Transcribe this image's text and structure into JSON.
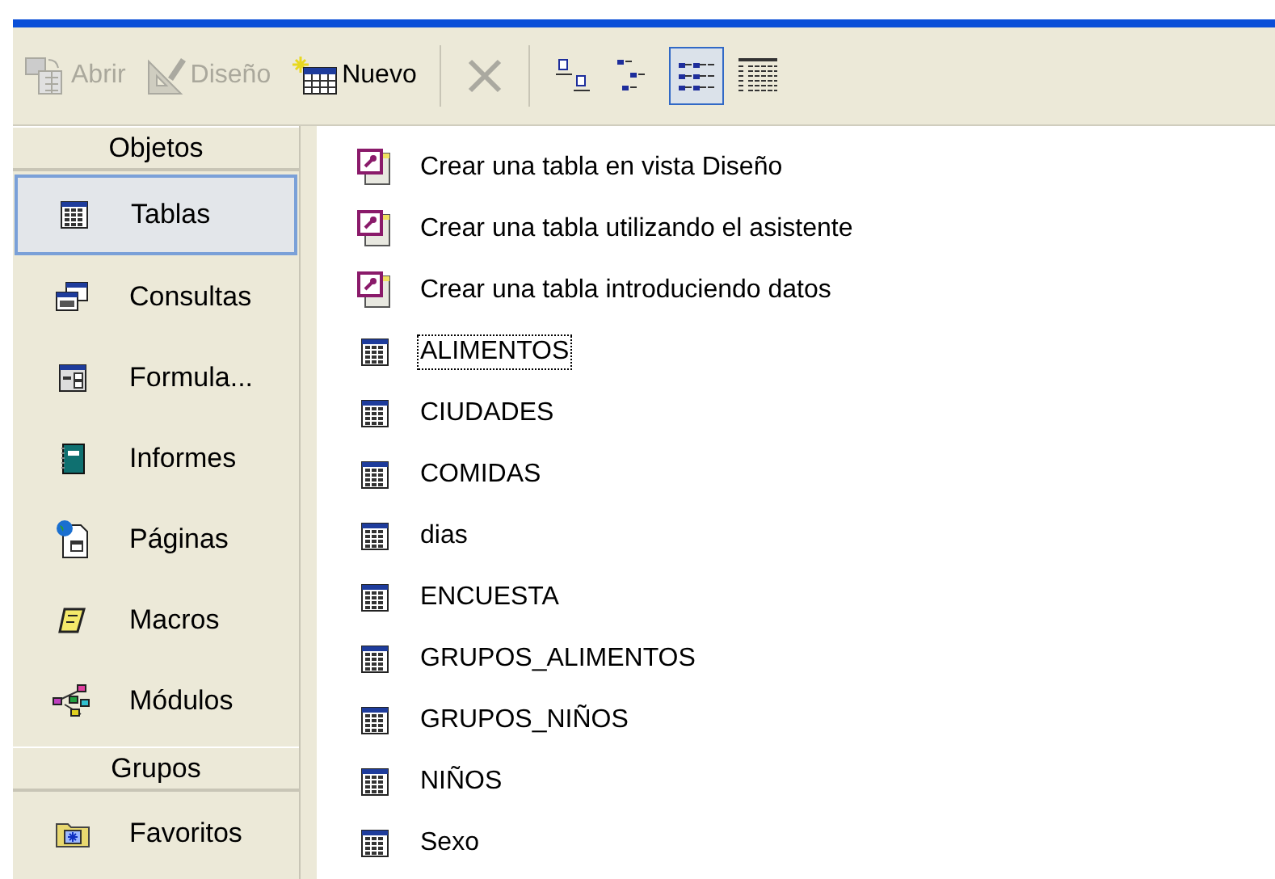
{
  "toolbar": [
    {
      "kind": "open",
      "label": "Abrir",
      "disabled": true
    },
    {
      "kind": "design",
      "label": "Diseño",
      "disabled": true
    },
    {
      "kind": "new",
      "label": "Nuevo",
      "disabled": false
    },
    {
      "kind": "delete",
      "disabled": true
    },
    {
      "kind": "large-icons",
      "selected": false
    },
    {
      "kind": "small-icons",
      "selected": false
    },
    {
      "kind": "list",
      "selected": true
    },
    {
      "kind": "details",
      "selected": false
    }
  ],
  "sidebar": {
    "sections": [
      {
        "title": "Objetos",
        "items": [
          {
            "kind": "tables",
            "label": "Tablas",
            "selected": true
          },
          {
            "kind": "queries",
            "label": "Consultas",
            "selected": false
          },
          {
            "kind": "forms",
            "label": "Formula...",
            "selected": false
          },
          {
            "kind": "reports",
            "label": "Informes",
            "selected": false
          },
          {
            "kind": "pages",
            "label": "Páginas",
            "selected": false
          },
          {
            "kind": "macros",
            "label": "Macros",
            "selected": false
          },
          {
            "kind": "modules",
            "label": "Módulos",
            "selected": false
          }
        ]
      },
      {
        "title": "Grupos",
        "items": [
          {
            "kind": "favorites",
            "label": "Favoritos",
            "selected": false
          }
        ]
      }
    ]
  },
  "objects": [
    {
      "kind": "wizard",
      "label": "Crear una tabla en vista Diseño",
      "focused": false
    },
    {
      "kind": "wizard",
      "label": "Crear una tabla utilizando el asistente",
      "focused": false
    },
    {
      "kind": "wizard",
      "label": "Crear una tabla introduciendo datos",
      "focused": false
    },
    {
      "kind": "table",
      "label": "ALIMENTOS",
      "focused": true
    },
    {
      "kind": "table",
      "label": "CIUDADES",
      "focused": false
    },
    {
      "kind": "table",
      "label": "COMIDAS",
      "focused": false
    },
    {
      "kind": "table",
      "label": "dias",
      "focused": false
    },
    {
      "kind": "table",
      "label": "ENCUESTA",
      "focused": false
    },
    {
      "kind": "table",
      "label": "GRUPOS_ALIMENTOS",
      "focused": false
    },
    {
      "kind": "table",
      "label": "GRUPOS_NIÑOS",
      "focused": false
    },
    {
      "kind": "table",
      "label": "NIÑOS",
      "focused": false
    },
    {
      "kind": "table",
      "label": "Sexo",
      "focused": false
    }
  ]
}
